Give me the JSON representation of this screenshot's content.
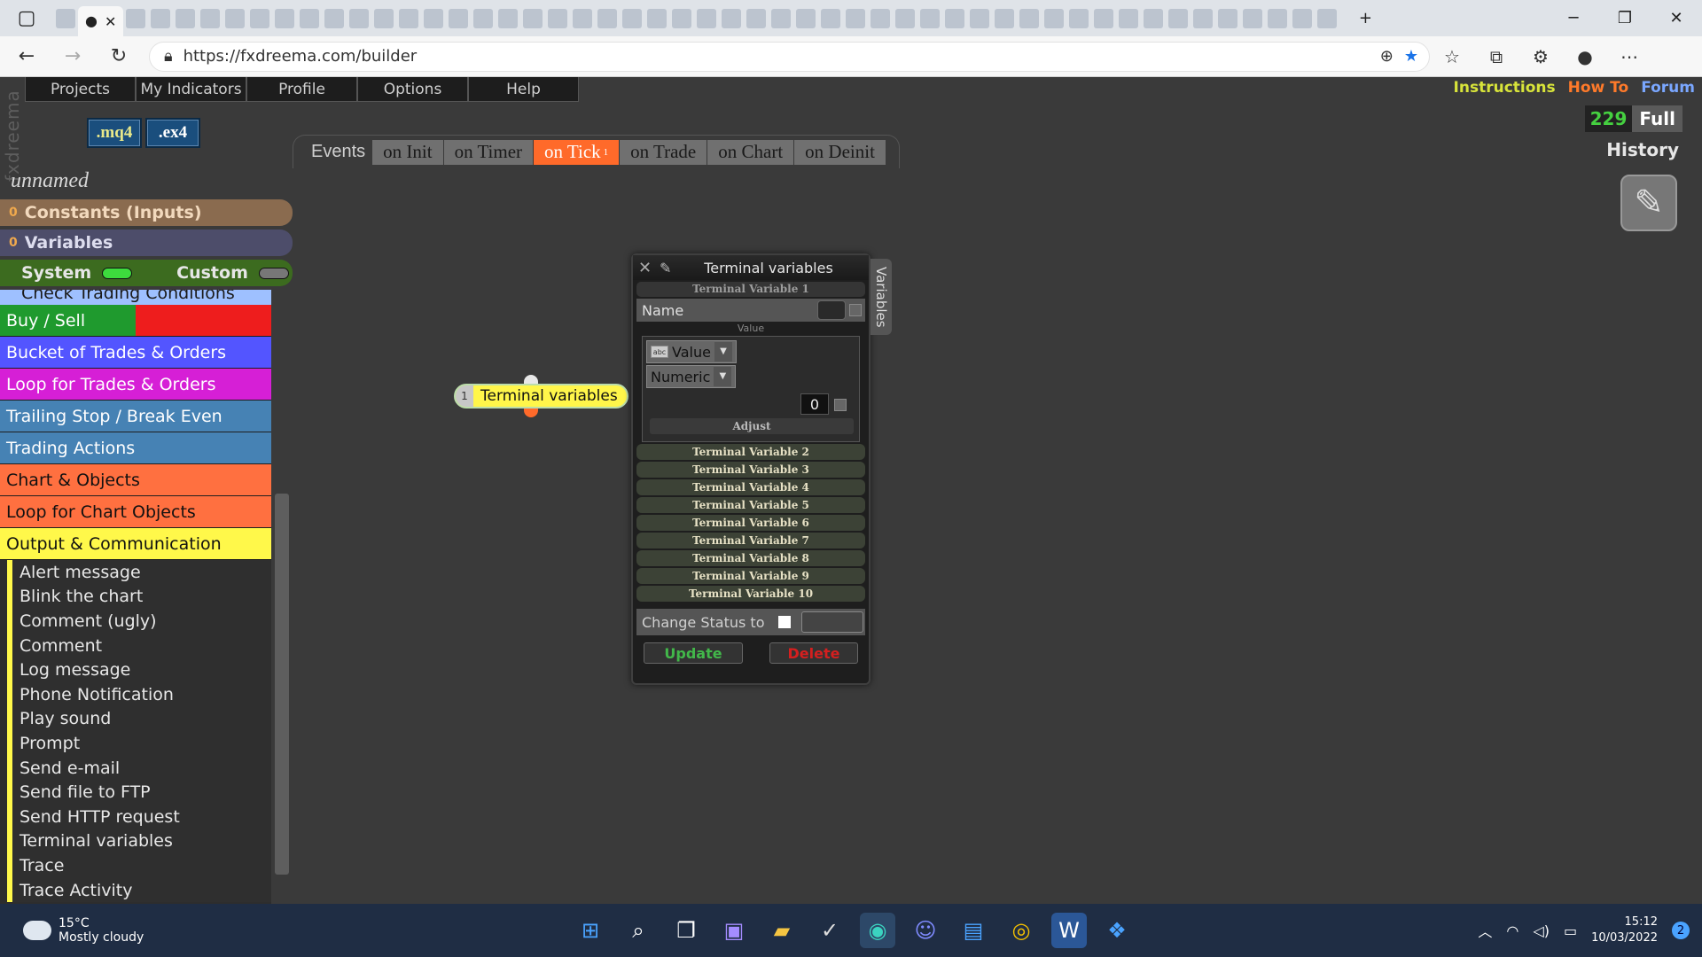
{
  "browser": {
    "url": "https://fxdreema.com/builder",
    "tab_close": "✕",
    "new_tab": "+"
  },
  "app": {
    "brand": "fxdreema",
    "menu": [
      "Projects",
      "My Indicators",
      "Profile",
      "Options",
      "Help"
    ],
    "links": [
      {
        "label": "Instructions",
        "color": "#d8e43a"
      },
      {
        "label": "How To",
        "color": "#ff7a2a"
      },
      {
        "label": "Forum",
        "color": "#7aa7ff"
      }
    ],
    "file_buttons": [
      ".mq4",
      ".ex4"
    ],
    "counter": "229",
    "full_label": "Full",
    "history_label": "History",
    "events_label": "Events",
    "events": [
      {
        "label": "on Init",
        "active": false
      },
      {
        "label": "on Timer",
        "active": false
      },
      {
        "label": "on Tick",
        "active": true,
        "count": "1"
      },
      {
        "label": "on Trade",
        "active": false
      },
      {
        "label": "on Chart",
        "active": false
      },
      {
        "label": "on Deinit",
        "active": false
      }
    ],
    "project_name": "unnamed",
    "constants_label": "Constants (Inputs)",
    "constants_count": "0",
    "variables_label": "Variables",
    "variables_count": "0",
    "system_label": "System",
    "custom_label": "Custom"
  },
  "sidebar": {
    "partial_category": "Check Trading Conditions",
    "categories": [
      {
        "label": "Buy / Sell",
        "color": "#1f9a2e"
      },
      {
        "label": "Bucket of Trades & Orders",
        "color": "#5355ff"
      },
      {
        "label": "Loop for Trades & Orders",
        "color": "#d61fd6"
      },
      {
        "label": "Trailing Stop / Break Even",
        "color": "#4682b4"
      },
      {
        "label": "Trading Actions",
        "color": "#4682b4"
      },
      {
        "label": "Chart & Objects",
        "color": "#ff7040"
      },
      {
        "label": "Loop for Chart Objects",
        "color": "#ff7040"
      },
      {
        "label": "Output & Communication",
        "color": "#fff84a"
      }
    ],
    "subitems": [
      "Alert message",
      "Blink the chart",
      "Comment (ugly)",
      "Comment",
      "Log message",
      "Phone Notification",
      "Play sound",
      "Prompt",
      "Send e-mail",
      "Send file to FTP",
      "Send HTTP request",
      "Terminal variables",
      "Trace",
      "Trace Activity"
    ]
  },
  "canvas_node": {
    "number": "1",
    "label": "Terminal variables"
  },
  "dialog": {
    "title": "Terminal variables",
    "side_tab": "Variables",
    "first_var": "Terminal Variable 1",
    "name_label": "Name",
    "value_label": "Value",
    "type_dropdown": "Value",
    "format_dropdown": "Numeric",
    "number_value": "0",
    "adjust_label": "Adjust",
    "other_vars": [
      "Terminal Variable 2",
      "Terminal Variable 3",
      "Terminal Variable 4",
      "Terminal Variable 5",
      "Terminal Variable 6",
      "Terminal Variable 7",
      "Terminal Variable 8",
      "Terminal Variable 9",
      "Terminal Variable 10"
    ],
    "status_label": "Change Status to",
    "update_label": "Update",
    "delete_label": "Delete"
  },
  "taskbar": {
    "temperature": "15°C",
    "weather": "Mostly cloudy",
    "time": "15:12",
    "date": "10/03/2022",
    "notification_count": "2"
  }
}
